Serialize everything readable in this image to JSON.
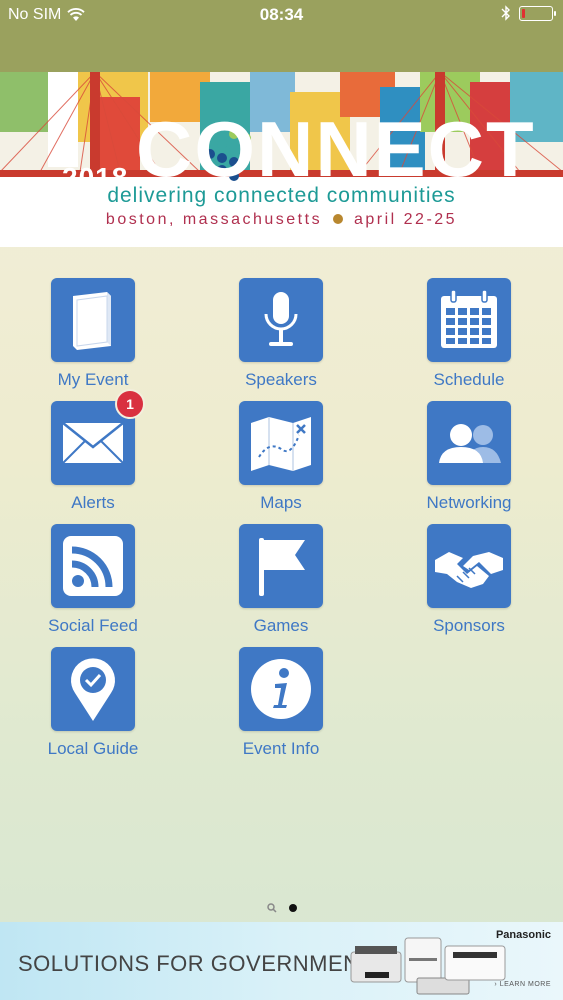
{
  "status_bar": {
    "carrier": "No SIM",
    "time": "08:34",
    "battery_level": 0.12
  },
  "banner": {
    "year": "2018",
    "logo": "CONNECT",
    "tagline": "delivering connected communities",
    "location": "boston, massachusetts",
    "dates": "april 22-25"
  },
  "tiles": [
    {
      "label": "My Event",
      "icon": "book-icon"
    },
    {
      "label": "Speakers",
      "icon": "microphone-icon"
    },
    {
      "label": "Schedule",
      "icon": "calendar-icon"
    },
    {
      "label": "Alerts",
      "icon": "envelope-icon",
      "badge": "1"
    },
    {
      "label": "Maps",
      "icon": "map-icon"
    },
    {
      "label": "Networking",
      "icon": "people-icon"
    },
    {
      "label": "Social Feed",
      "icon": "rss-icon"
    },
    {
      "label": "Games",
      "icon": "flag-icon"
    },
    {
      "label": "Sponsors",
      "icon": "handshake-icon"
    },
    {
      "label": "Local Guide",
      "icon": "location-pin-icon"
    },
    {
      "label": "Event Info",
      "icon": "info-icon"
    }
  ],
  "ad": {
    "text": "SOLUTIONS FOR GOVERNMENT",
    "brand": "Panasonic",
    "cta": "LEARN MORE"
  },
  "colors": {
    "tile_blue": "#3f78c5",
    "status_bar": "#9aa15e",
    "badge_red": "#d93040"
  }
}
